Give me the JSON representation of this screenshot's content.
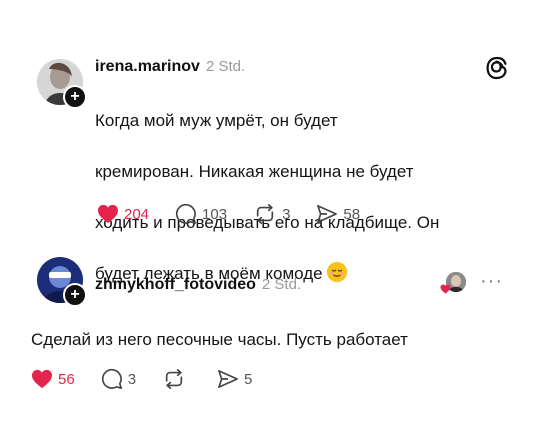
{
  "post1": {
    "username": "irena.marinov",
    "time": "2 Std.",
    "text_lines": [
      "Когда мой муж умрёт, он будет",
      "кремирован. Никакая женщина не будет",
      "ходить и проведывать его на кладбище. Он",
      "будет лежать в моём комоде"
    ],
    "likes": "204",
    "replies": "103",
    "reposts": "3",
    "shares": "58",
    "accent": "#e5244d"
  },
  "post2": {
    "username": "zhmykhoff_fotovideo",
    "time": "2 Std.",
    "text": "Сделай из него песочные часы. Пусть работает",
    "likes": "56",
    "replies": "3",
    "reposts": "",
    "shares": "5",
    "accent": "#e5244d"
  },
  "icons": {
    "threads": "threads-logo-icon",
    "heart": "heart-icon",
    "reply": "comment-icon",
    "repost": "repost-icon",
    "share": "send-icon",
    "more": "more-icon"
  }
}
